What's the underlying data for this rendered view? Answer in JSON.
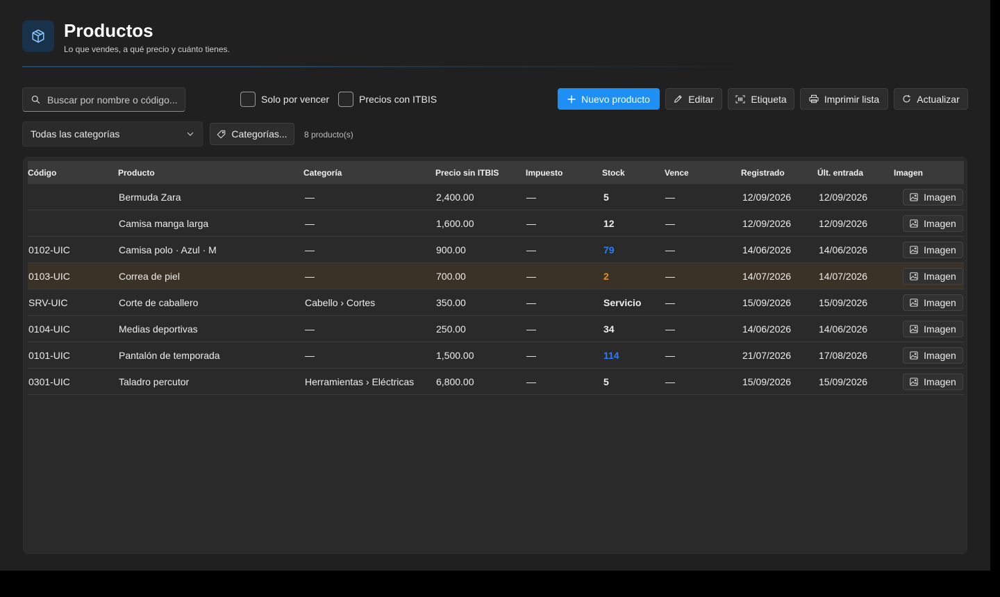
{
  "header": {
    "title": "Productos",
    "subtitle": "Lo que vendes, a qué precio y cuánto tienes.",
    "icon": "box-icon"
  },
  "toolbar": {
    "search_placeholder": "Buscar por nombre o código...",
    "search_value": "",
    "check_expiring": "Solo por vencer",
    "check_itbis": "Precios con ITBIS",
    "new_label": "Nuevo producto",
    "edit_label": "Editar",
    "label_label": "Etiqueta",
    "print_label": "Imprimir lista",
    "refresh_label": "Actualizar",
    "category_select": "Todas las categorías",
    "categories_label": "Categorías...",
    "count_text": "8 producto(s)"
  },
  "colors": {
    "accent": "#1e90f5",
    "stock_blue": "#2f7bf0",
    "stock_orange": "#e0902a",
    "warn_row": "#3a3226"
  },
  "table": {
    "columns": [
      "Código",
      "Producto",
      "Categoría",
      "Precio sin ITBIS",
      "Impuesto",
      "Stock",
      "Vence",
      "Registrado",
      "Últ. entrada",
      "Imagen"
    ],
    "image_button": "Imagen",
    "rows": [
      {
        "code": "",
        "product": "Bermuda Zara",
        "category": "—",
        "price": "2,400.00",
        "tax": "—",
        "stock": "5",
        "stock_color": "",
        "expires": "—",
        "registered": "12/09/2026",
        "last_entry": "12/09/2026",
        "highlight": false
      },
      {
        "code": "",
        "product": "Camisa manga larga",
        "category": "—",
        "price": "1,600.00",
        "tax": "—",
        "stock": "12",
        "stock_color": "",
        "expires": "—",
        "registered": "12/09/2026",
        "last_entry": "12/09/2026",
        "highlight": false
      },
      {
        "code": "0102-UIC",
        "product": "Camisa polo · Azul · M",
        "category": "—",
        "price": "900.00",
        "tax": "—",
        "stock": "79",
        "stock_color": "#2f7bf0",
        "expires": "—",
        "registered": "14/06/2026",
        "last_entry": "14/06/2026",
        "highlight": false
      },
      {
        "code": "0103-UIC",
        "product": "Correa de piel",
        "category": "—",
        "price": "700.00",
        "tax": "—",
        "stock": "2",
        "stock_color": "#e0902a",
        "expires": "—",
        "registered": "14/07/2026",
        "last_entry": "14/07/2026",
        "highlight": true
      },
      {
        "code": "SRV-UIC",
        "product": "Corte de caballero",
        "category": "Cabello › Cortes",
        "price": "350.00",
        "tax": "—",
        "stock": "Servicio",
        "stock_color": "",
        "expires": "—",
        "registered": "15/09/2026",
        "last_entry": "15/09/2026",
        "highlight": false
      },
      {
        "code": "0104-UIC",
        "product": "Medias deportivas",
        "category": "—",
        "price": "250.00",
        "tax": "—",
        "stock": "34",
        "stock_color": "",
        "expires": "—",
        "registered": "14/06/2026",
        "last_entry": "14/06/2026",
        "highlight": false
      },
      {
        "code": "0101-UIC",
        "product": "Pantalón de temporada",
        "category": "—",
        "price": "1,500.00",
        "tax": "—",
        "stock": "114",
        "stock_color": "#2f7bf0",
        "expires": "—",
        "registered": "21/07/2026",
        "last_entry": "17/08/2026",
        "highlight": false
      },
      {
        "code": "0301-UIC",
        "product": "Taladro percutor",
        "category": "Herramientas › Eléctricas",
        "price": "6,800.00",
        "tax": "—",
        "stock": "5",
        "stock_color": "",
        "expires": "—",
        "registered": "15/09/2026",
        "last_entry": "15/09/2026",
        "highlight": false
      }
    ]
  }
}
